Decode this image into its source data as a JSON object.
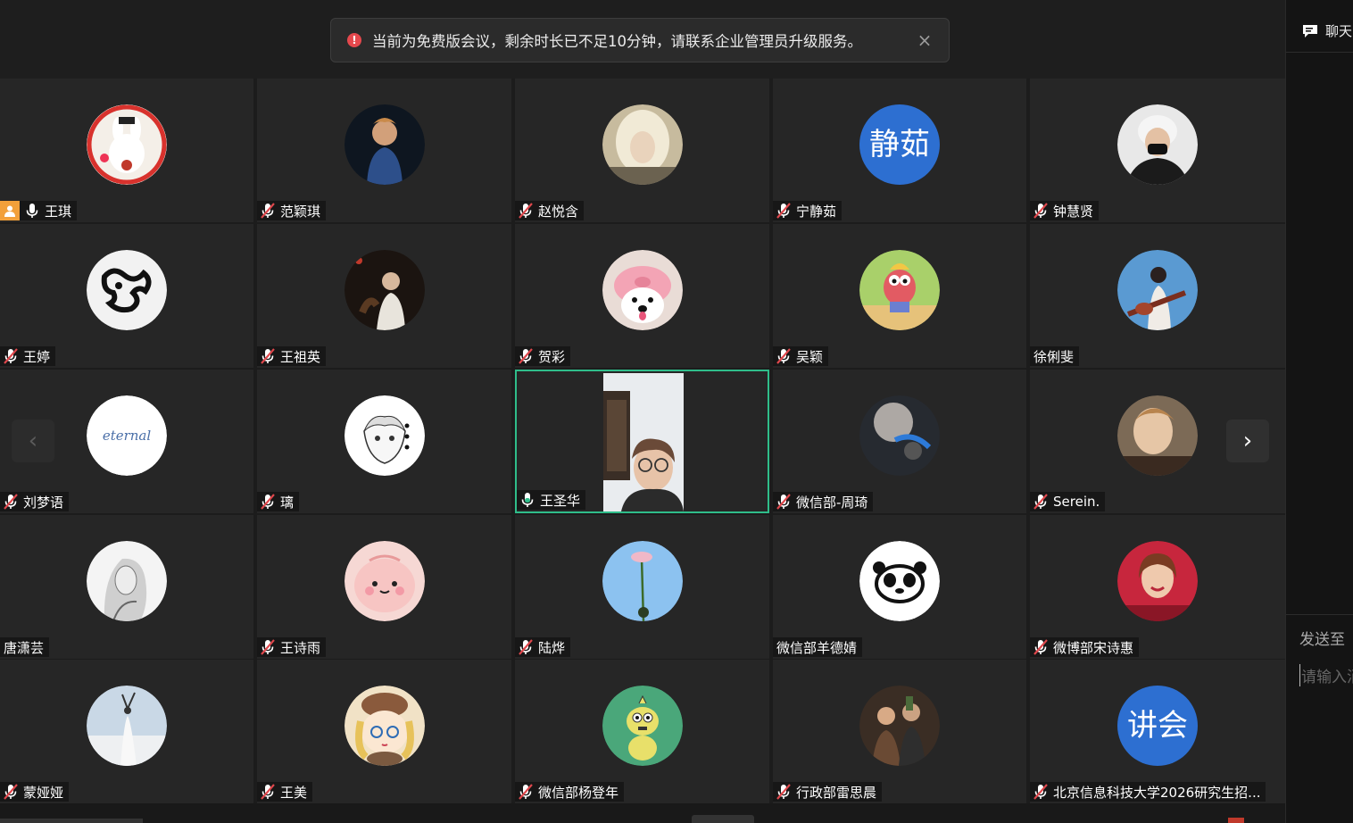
{
  "notice": {
    "message": "当前为免费版会议，剩余时长已不足10分钟，请联系企业管理员升级服务。",
    "close_glyph": "×"
  },
  "participants": [
    {
      "name": "王琪",
      "mic": "on",
      "host": true,
      "avatar": "bunny"
    },
    {
      "name": "范颖琪",
      "mic": "muted",
      "avatar": "photo-man"
    },
    {
      "name": "赵悦含",
      "mic": "muted",
      "avatar": "photo-blonde"
    },
    {
      "name": "宁静茹",
      "mic": "muted",
      "avatar_text": "静茹"
    },
    {
      "name": "钟慧贤",
      "mic": "muted",
      "avatar": "photo-mask"
    },
    {
      "name": "王婷",
      "mic": "muted",
      "avatar": "ink-face"
    },
    {
      "name": "王祖英",
      "mic": "muted",
      "avatar": "photo-dark"
    },
    {
      "name": "贺彩",
      "mic": "muted",
      "avatar": "dog-pig-hat"
    },
    {
      "name": "吴颖",
      "mic": "muted",
      "avatar": "cartoon-fish"
    },
    {
      "name": "徐俐斐",
      "mic": "none",
      "avatar": "photo-guitar"
    },
    {
      "name": "刘梦语",
      "mic": "muted",
      "avatar": "eternal-text",
      "avatar_caption": "eternal"
    },
    {
      "name": "璃",
      "mic": "muted",
      "avatar": "anime-sketch"
    },
    {
      "name": "王圣华",
      "mic": "on",
      "avatar": "video",
      "active": true
    },
    {
      "name": "微信部-周琦",
      "mic": "muted",
      "avatar": "photo-light"
    },
    {
      "name": "Serein.",
      "mic": "muted",
      "avatar": "photo-selfie"
    },
    {
      "name": "唐潇芸",
      "mic": "none",
      "avatar": "sketch-girl"
    },
    {
      "name": "王诗雨",
      "mic": "muted",
      "avatar": "pink-blob"
    },
    {
      "name": "陆烨",
      "mic": "muted",
      "avatar": "sky-flower"
    },
    {
      "name": "微信部羊德婧",
      "mic": "none",
      "avatar": "panda"
    },
    {
      "name": "微博部宋诗惠",
      "mic": "muted",
      "avatar": "photo-red"
    },
    {
      "name": "蒙娅娅",
      "mic": "muted",
      "avatar": "photo-dancer"
    },
    {
      "name": "王美",
      "mic": "muted",
      "avatar": "anime-bear"
    },
    {
      "name": "微信部杨登年",
      "mic": "muted",
      "avatar": "cartoon-green"
    },
    {
      "name": "行政部雷思晨",
      "mic": "muted",
      "avatar": "photo-group"
    },
    {
      "name": "北京信息科技大学2026研究生招...",
      "mic": "muted",
      "avatar_text": "讲会"
    }
  ],
  "nav": {
    "prev_glyph": "‹",
    "next_glyph": "›"
  },
  "sidebar": {
    "chat_tab": "聊天",
    "send_to": "发送至",
    "input_placeholder": "请输入消息"
  },
  "colors": {
    "active_border": "#2fbd8a",
    "avatar_blue": "#2d6fd1",
    "host_badge": "#f2a03a",
    "muted_red": "#e0484d"
  }
}
